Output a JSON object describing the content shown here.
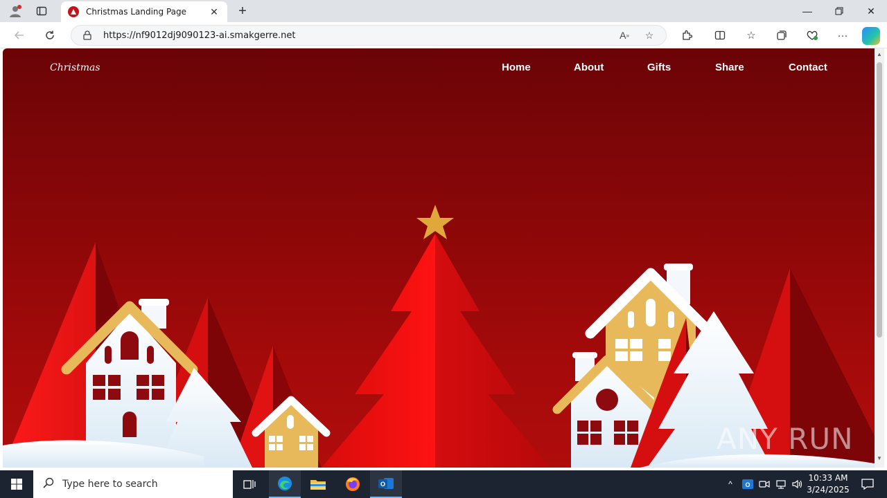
{
  "browser": {
    "tab_title": "Christmas Landing Page",
    "url": "https://nf9012dj9090123-ai.smakgerre.net",
    "icons": [
      "profile-icon",
      "tab-actions-icon",
      "close-tab-icon",
      "new-tab-icon",
      "minimize-icon",
      "restore-icon",
      "close-window-icon",
      "back-icon",
      "refresh-icon",
      "lock-icon",
      "read-aloud-icon",
      "favorite-add-icon",
      "extensions-icon",
      "split-screen-icon",
      "favorites-icon",
      "collections-icon",
      "browser-essentials-icon",
      "more-icon",
      "copilot-icon"
    ]
  },
  "site": {
    "brand": "Christmas",
    "nav": [
      "Home",
      "About",
      "Gifts",
      "Share",
      "Contact"
    ]
  },
  "watermark": "ANY RUN",
  "taskbar": {
    "search_placeholder": "Type here to search",
    "time": "10:33 AM",
    "date": "3/24/2025"
  },
  "colors": {
    "hero_dark": "#6b0407",
    "hero_light": "#b00d0c",
    "tree_red": "#e10d10",
    "gold": "#e8b95a",
    "snow": "#f4f8fc"
  }
}
